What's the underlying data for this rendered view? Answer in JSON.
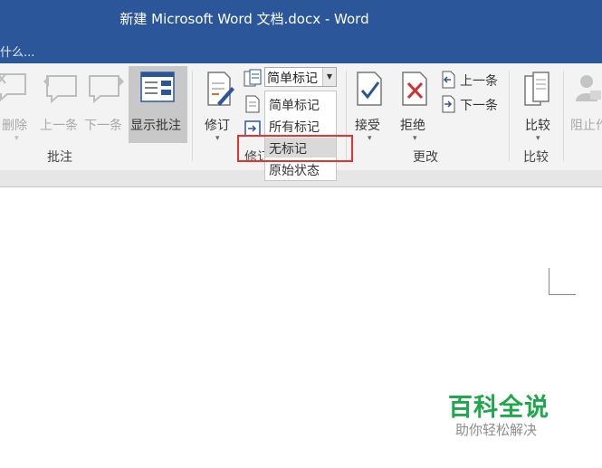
{
  "window": {
    "title": "新建 Microsoft Word 文档.docx - Word"
  },
  "tell_me": {
    "text": "什么..."
  },
  "ribbon": {
    "comments_group": {
      "label": "批注",
      "delete_label": "删除",
      "previous_label": "上一条",
      "next_label": "下一条",
      "show_comments_label": "显示批注"
    },
    "tracking_group": {
      "label": "修订",
      "track_changes_label": "修订",
      "markup_combo_value": "简单标记"
    },
    "changes_group": {
      "label": "更改",
      "accept_label": "接受",
      "reject_label": "拒绝",
      "previous_label": "上一条",
      "next_label": "下一条"
    },
    "compare_group": {
      "label": "比较",
      "compare_label": "比较"
    },
    "protect_group": {
      "block_label": "阻止作"
    }
  },
  "markup_dropdown": {
    "options": [
      "简单标记",
      "所有标记",
      "无标记",
      "原始状态"
    ],
    "highlighted": "无标记"
  },
  "watermark": {
    "title": "百科全说",
    "subtitle": "助你轻松解决"
  },
  "colors": {
    "title_bar": "#2b579a",
    "highlight_box": "#e5332f",
    "watermark_green": "#1fa84b"
  }
}
